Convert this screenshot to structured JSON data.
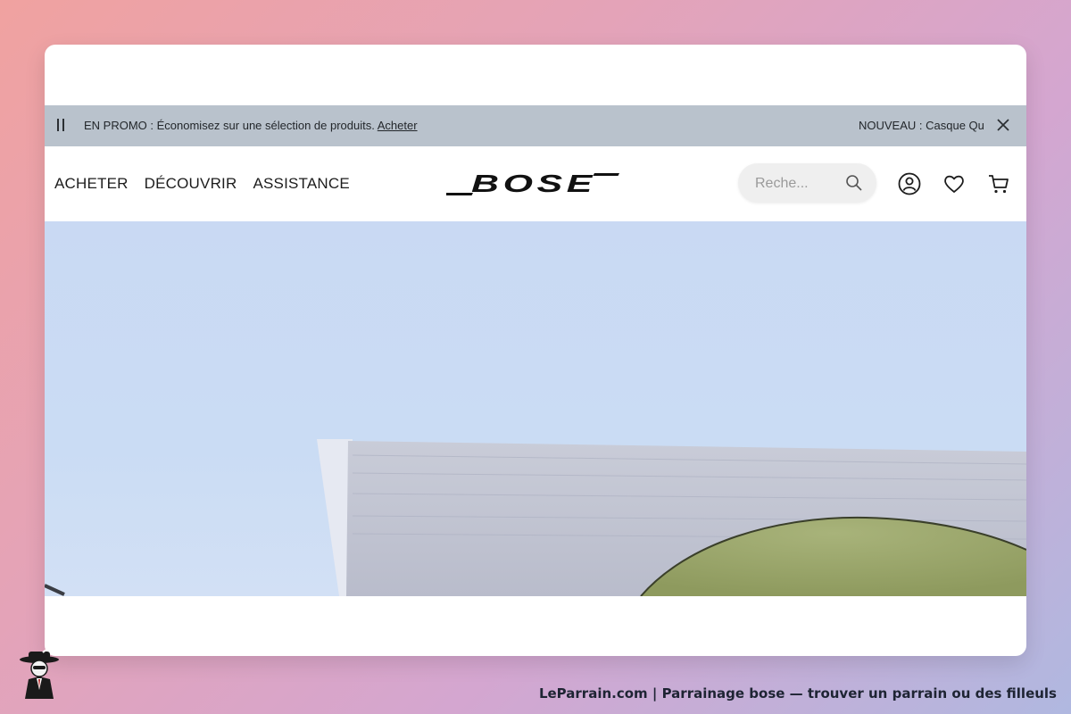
{
  "promo_bar": {
    "left_prefix": "EN PROMO : Économisez sur une sélection de produits. ",
    "left_link": "Acheter",
    "right_text": "NOUVEAU : Casque Qu",
    "bg_color": "#b9c2cc"
  },
  "header": {
    "nav": [
      "ACHETER",
      "DÉCOUVRIR",
      "ASSISTANCE"
    ],
    "logo": "BOSE",
    "search_placeholder": "Reche...",
    "icons": [
      "search-icon",
      "account-icon",
      "heart-icon",
      "cart-icon"
    ]
  },
  "hero": {
    "sky_color": "#cadcf4",
    "product_color": "#9aa66a"
  },
  "footer": {
    "caption": "LeParrain.com | Parrainage bose — trouver un parrain ou des filleuls"
  }
}
